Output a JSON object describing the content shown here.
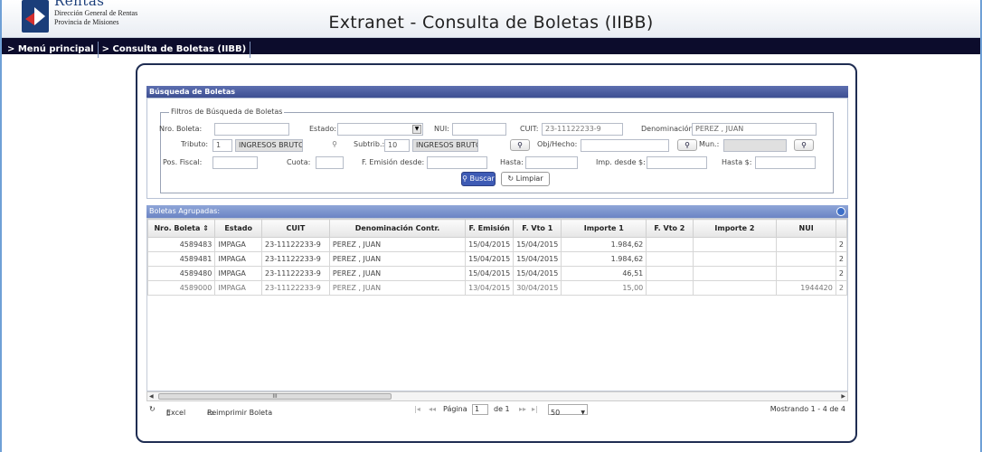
{
  "header": {
    "logo_rentas": "Rentas",
    "logo_line1": "Dirección General de Rentas",
    "logo_line2": "Provincia de Misiones",
    "title": "Extranet - Consulta de Boletas (IIBB)"
  },
  "breadcrumb": {
    "items": [
      "> Menú principal",
      "> Consulta de Boletas (IIBB)"
    ]
  },
  "search": {
    "section_title": "Búsqueda de Boletas",
    "legend": "Filtros de Búsqueda de Boletas",
    "nro_boleta_label": "Nro. Boleta:",
    "nro_boleta_value": "",
    "estado_label": "Estado:",
    "estado_value": "",
    "nui_label": "NUI:",
    "nui_value": "",
    "cuit_label": "CUIT:",
    "cuit_value": "23-11122233-9",
    "denominacion_label": "Denominación:",
    "denominacion_value": "PEREZ , JUAN",
    "tributo_label": "Tributo:",
    "tributo_code": "1",
    "tributo_desc": "INGRESOS BRUTOS",
    "subtrib_label": "Subtrib.:",
    "subtrib_code": "10",
    "subtrib_desc": "INGRESOS BRUTOS D",
    "obj_hecho_label": "Obj/Hecho:",
    "obj_hecho_value": "",
    "mun_label": "Mun.:",
    "mun_value": "",
    "pos_fiscal_label": "Pos. Fiscal:",
    "cuota_label": "Cuota:",
    "f_emision_desde_label": "F. Emisión desde:",
    "hasta_label": "Hasta:",
    "imp_desde_label": "Imp. desde $:",
    "hasta_importe_label": "Hasta $:",
    "buscar_label": "Buscar",
    "limpiar_label": "Limpiar"
  },
  "grid": {
    "title": "Boletas Agrupadas:",
    "columns": [
      "Nro. Boleta",
      "Estado",
      "CUIT",
      "Denominación Contr.",
      "F. Emisión",
      "F. Vto 1",
      "Importe 1",
      "F. Vto 2",
      "Importe 2",
      "NUI"
    ],
    "rows": [
      {
        "nro": "4589483",
        "estado": "IMPAGA",
        "cuit": "23-11122233-9",
        "denom": "PEREZ , JUAN",
        "f_emision": "15/04/2015",
        "f_vto1": "15/04/2015",
        "importe1": "1.984,62",
        "f_vto2": "",
        "importe2": "",
        "nui": "",
        "extra": "2"
      },
      {
        "nro": "4589481",
        "estado": "IMPAGA",
        "cuit": "23-11122233-9",
        "denom": "PEREZ , JUAN",
        "f_emision": "15/04/2015",
        "f_vto1": "15/04/2015",
        "importe1": "1.984,62",
        "f_vto2": "",
        "importe2": "",
        "nui": "",
        "extra": "2"
      },
      {
        "nro": "4589480",
        "estado": "IMPAGA",
        "cuit": "23-11122233-9",
        "denom": "PEREZ , JUAN",
        "f_emision": "15/04/2015",
        "f_vto1": "15/04/2015",
        "importe1": "46,51",
        "f_vto2": "",
        "importe2": "",
        "nui": "",
        "extra": "2"
      },
      {
        "nro": "4589000",
        "estado": "IMPAGA",
        "cuit": "23-11122233-9",
        "denom": "PEREZ , JUAN",
        "f_emision": "13/04/2015",
        "f_vto1": "30/04/2015",
        "importe1": "15,00",
        "f_vto2": "",
        "importe2": "",
        "nui": "1944420",
        "extra": "2"
      }
    ],
    "scroll_thumb": "III"
  },
  "footer": {
    "excel_label": "Excel",
    "reimprimir_label": "Reimprimir Boleta",
    "pagina_label": "Página",
    "page_value": "1",
    "of_pages": "de 1",
    "page_size": "50",
    "status": "Mostrando 1 - 4 de 4"
  },
  "colors": {
    "nav_bg": "#0c0c2c",
    "section_bar": "#3d4f92",
    "grid_header": "#6b84c4",
    "buscar_bg": "#3e5bb5"
  }
}
